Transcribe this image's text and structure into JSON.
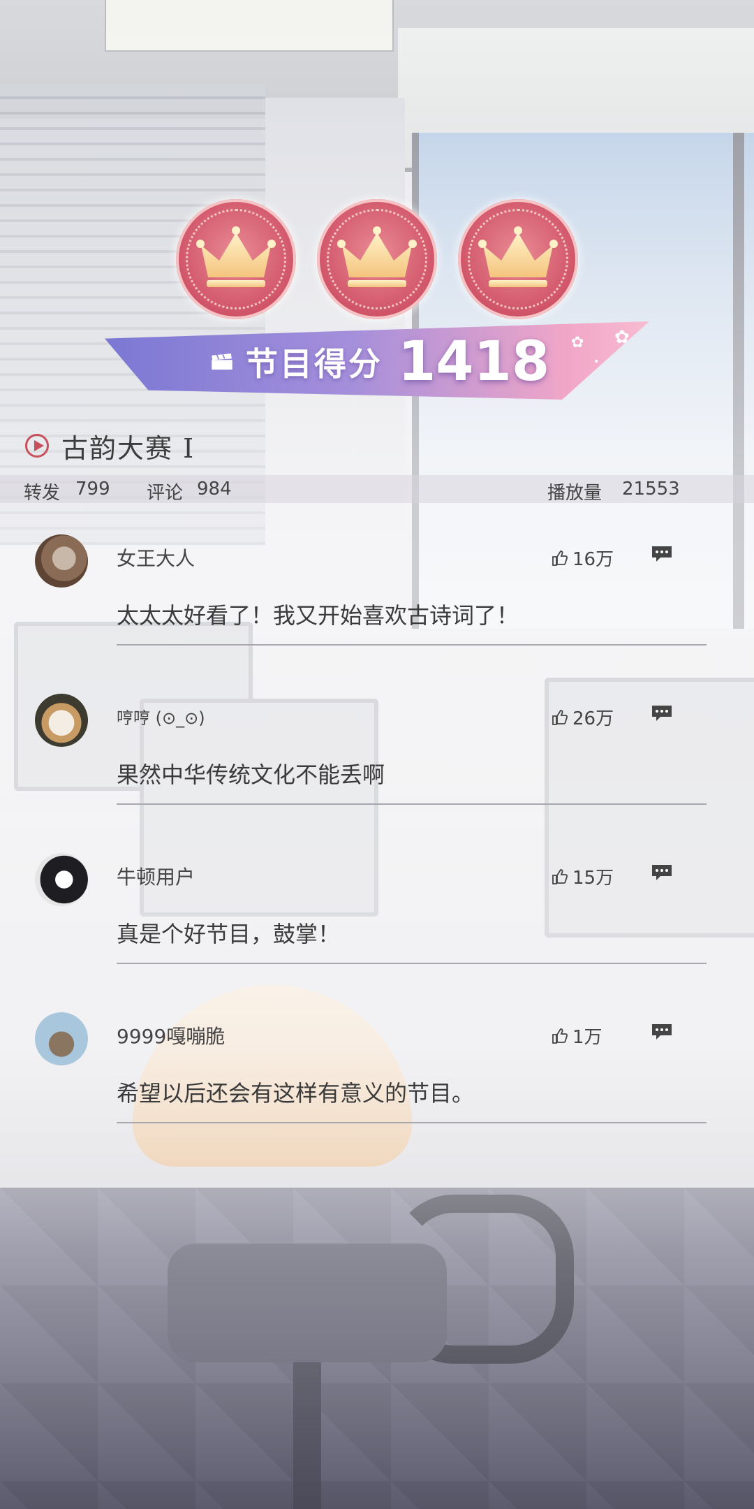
{
  "score_banner": {
    "label": "节目得分",
    "value": "1418",
    "crowns": 3,
    "icons": [
      "crown-medal-icon",
      "clapperboard-icon"
    ]
  },
  "program": {
    "title": "古韵大赛 I"
  },
  "stats": {
    "repost_label": "转发",
    "repost_count": "799",
    "comment_label": "评论",
    "comment_count": "984",
    "views_label": "播放量",
    "views_count": "21553"
  },
  "comments": [
    {
      "user": "女王大人",
      "likes": "16万",
      "text": "太太太好看了！我又开始喜欢古诗词了！"
    },
    {
      "user": "哼哼 (⊙_⊙)",
      "likes": "26万",
      "text": "果然中华传统文化不能丢啊"
    },
    {
      "user": "牛顿用户",
      "likes": "15万",
      "text": "真是个好节目，鼓掌！"
    },
    {
      "user": "9999嘎嘣脆",
      "likes": "1万",
      "text": "希望以后还会有这样有意义的节目。"
    }
  ],
  "colors": {
    "medal": "#cf5266",
    "banner_left": "#7b78d3",
    "banner_right": "#f7bcd1",
    "play_accent": "#c8505c"
  }
}
